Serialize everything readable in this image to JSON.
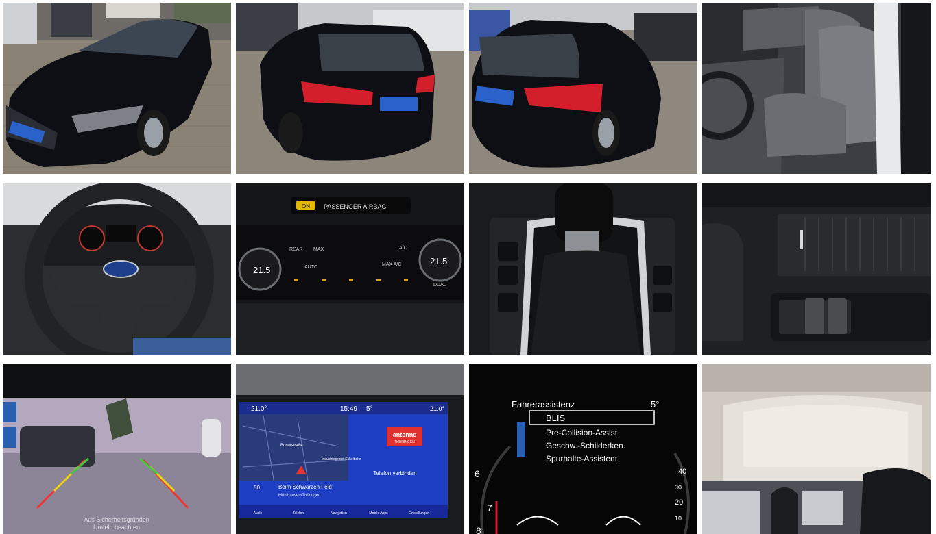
{
  "gallery": {
    "photos": [
      {
        "name": "front-three-quarter-view"
      },
      {
        "name": "rear-three-quarter-left"
      },
      {
        "name": "rear-three-quarter-right"
      },
      {
        "name": "front-seats-interior"
      },
      {
        "name": "steering-wheel-dashboard"
      },
      {
        "name": "climate-control-panel"
      },
      {
        "name": "gear-shifter-console"
      },
      {
        "name": "center-console-storage"
      },
      {
        "name": "rear-view-camera"
      },
      {
        "name": "infotainment-navigation"
      },
      {
        "name": "driver-assistance-menu"
      },
      {
        "name": "interior-roof-headliner"
      }
    ]
  },
  "climate": {
    "airbag_label": "PASSENGER AIRBAG",
    "airbag_status": "ON",
    "temp_left": "21.5",
    "temp_right": "21.5",
    "rear": "REAR",
    "max": "MAX",
    "ac": "A/C",
    "auto": "AUTO",
    "max_ac": "MAX A/C",
    "dual": "DUAL"
  },
  "camera": {
    "warning_line1": "Aus Sicherheitsgründen",
    "warning_line2": "Umfeld beachten"
  },
  "nav": {
    "temp_left": "21.0°",
    "time": "15:49",
    "outside": "5°",
    "temp_right": "21.0°",
    "street1": "Bonatstraße",
    "street2": "Industriegebiet Schelbeke",
    "route": "Beim Schwarzen Feld",
    "city": "Mühlhausen/Thüringen",
    "speed": "50",
    "radio": "antenne",
    "radio_sub": "THÜRINGEN",
    "phone": "Telefon verbinden",
    "tabs": [
      "Audio",
      "Telefon",
      "Navigation",
      "Mobile Apps",
      "Einstellungen"
    ]
  },
  "assist": {
    "title": "Fahrerassistenz",
    "temp": "5°",
    "items": [
      "BLIS",
      "Pre-Collision-Assist",
      "Geschw.-Schilderken.",
      "Spurhalte-Assistent"
    ],
    "gauge_labels": [
      "6",
      "7",
      "8",
      "40",
      "30",
      "20",
      "10"
    ]
  },
  "colors": {
    "car_body": "#0d0f14",
    "taillight": "#d21f2b",
    "plate_blue": "#2a62c9",
    "nav_blue": "#2447c7",
    "radio_red": "#e03030"
  }
}
